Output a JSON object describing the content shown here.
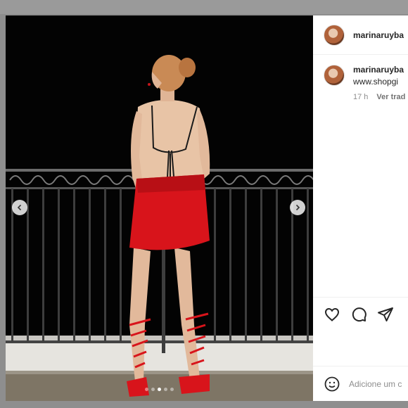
{
  "post": {
    "username": "marinaruyba",
    "caption_text": "www.shopgi",
    "time_ago": "17 h",
    "translate_label": "Ver trad"
  },
  "carousel": {
    "slide_count": 5,
    "active_index": 2
  },
  "comment": {
    "placeholder": "Adicione um c"
  },
  "icons": {
    "prev": "chevron-left-icon",
    "next": "chevron-right-icon",
    "like": "heart-icon",
    "comment": "comment-bubble-icon",
    "share": "paper-plane-icon",
    "emoji": "emoji-icon"
  },
  "colors": {
    "dress": "#d8141b",
    "background": "#000000",
    "panel": "#ffffff"
  }
}
